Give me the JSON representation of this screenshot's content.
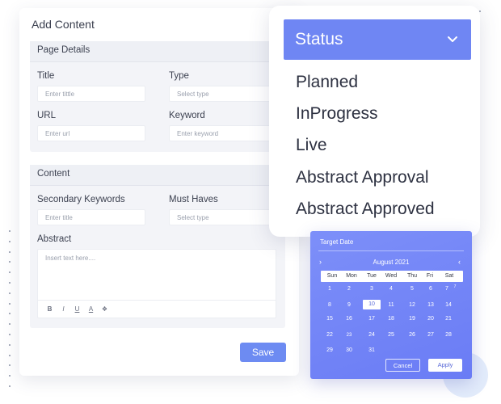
{
  "form": {
    "title": "Add Content",
    "page_details": {
      "heading": "Page Details",
      "title_label": "Title",
      "title_placeholder": "Enter tittle",
      "type_label": "Type",
      "type_placeholder": "Select type",
      "url_label": "URL",
      "url_placeholder": "Enter url",
      "keyword_label": "Keyword",
      "keyword_placeholder": "Enter keyword"
    },
    "content": {
      "heading": "Content",
      "secondary_label": "Secondary Keywords",
      "secondary_placeholder": "Enter title",
      "must_label": "Must Haves",
      "must_placeholder": "Select type",
      "abstract_label": "Abstract",
      "abstract_placeholder": "Insert text here....",
      "toolbar": [
        "B",
        "I",
        "U",
        "A",
        "❖"
      ]
    },
    "save_label": "Save"
  },
  "status": {
    "selected": "Status",
    "options": [
      "Planned",
      "InProgress",
      "Live",
      "Abstract Approval",
      "Abstract Approved"
    ]
  },
  "calendar": {
    "title": "Target Date",
    "month": "August 2021",
    "prev": "›",
    "next": "‹",
    "weekdays": [
      "Sun",
      "Mon",
      "Tue",
      "Wed",
      "Thu",
      "Fri",
      "Sat"
    ],
    "weeks": [
      [
        "1",
        "2",
        "3",
        "4",
        "5",
        "6",
        "7"
      ],
      [
        "8",
        "9",
        "10",
        "11",
        "12",
        "13",
        "14"
      ],
      [
        "15",
        "16",
        "17",
        "18",
        "19",
        "20",
        "21"
      ],
      [
        "22",
        "23",
        "24",
        "25",
        "26",
        "27",
        "28"
      ],
      [
        "29",
        "30",
        "31"
      ]
    ],
    "superscript": "7",
    "selected_day": "10",
    "cancel_label": "Cancel",
    "apply_label": "Apply"
  },
  "colors": {
    "accent": "#6d8bf2",
    "status_header": "#6f86f3",
    "calendar_bg": "#7383f7"
  }
}
